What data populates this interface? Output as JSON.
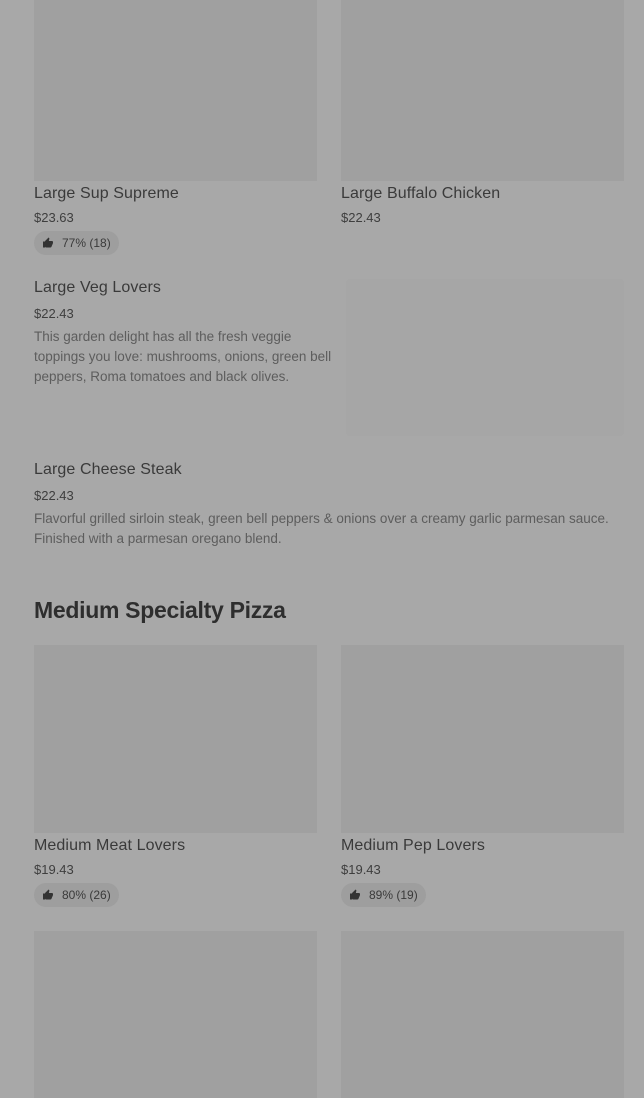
{
  "large_items": [
    {
      "title": "Large Sup Supreme",
      "price": "$23.63",
      "rating": "77% (18)"
    },
    {
      "title": "Large Buffalo Chicken",
      "price": "$22.43"
    },
    {
      "title": "Large Veg Lovers",
      "price": "$22.43",
      "description": "This garden delight has all the fresh veggie toppings you love: mushrooms, onions, green bell peppers, Roma tomatoes and black olives."
    },
    {
      "title": "Large Cheese Steak",
      "price": "$22.43",
      "description": "Flavorful grilled sirloin steak, green bell peppers & onions over a creamy garlic parmesan sauce. Finished with a parmesan oregano blend."
    }
  ],
  "medium_section": {
    "heading": "Medium Specialty Pizza",
    "items": [
      {
        "title": "Medium Meat Lovers",
        "price": "$19.43",
        "rating": "80% (26)"
      },
      {
        "title": "Medium Pep Lovers",
        "price": "$19.43",
        "rating": "89% (19)"
      }
    ]
  },
  "icons": {
    "rating": "thumbs-up-icon"
  },
  "colors": {
    "overlay_bg": "#a8a8a8",
    "image_placeholder": "#a0a0a0"
  }
}
